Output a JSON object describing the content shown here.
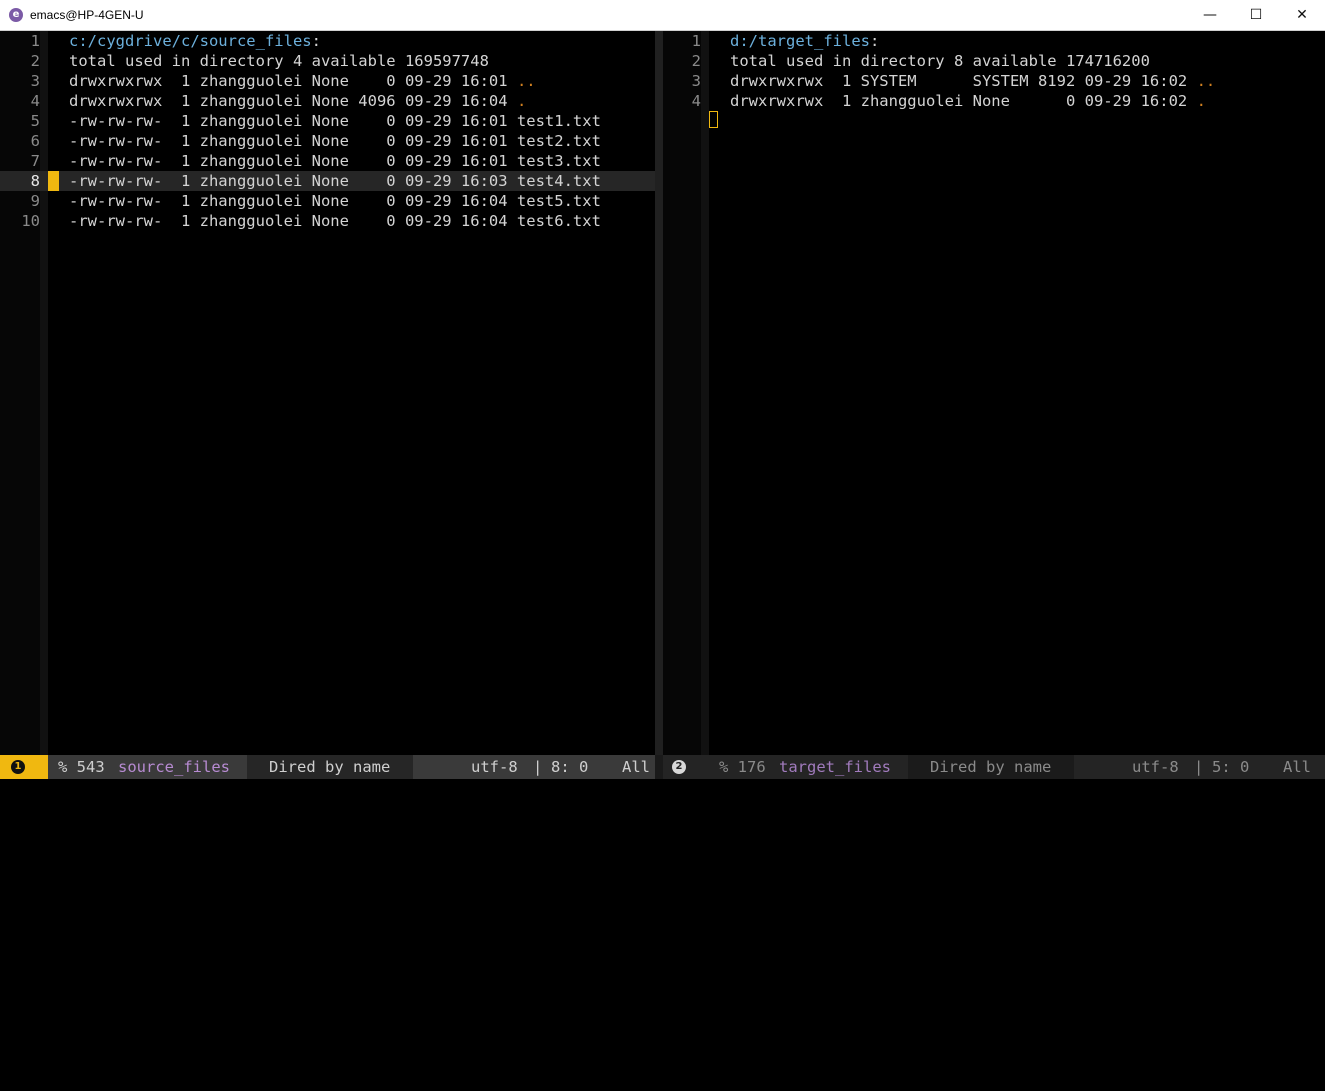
{
  "window": {
    "title": "emacs@HP-4GEN-U",
    "app_icon": "emacs-icon",
    "controls": {
      "minimize": "—",
      "maximize": "☐",
      "close": "✕"
    }
  },
  "left_pane": {
    "lines": [
      {
        "num": "1",
        "path": "c:/cygdrive/c/source_files",
        "suffix": ":"
      },
      {
        "num": "2",
        "text": "total used in directory 4 available 169597748"
      },
      {
        "num": "3",
        "text": "drwxrwxrwx  1 zhangguolei None    0 09-29 16:01 ",
        "link": ".."
      },
      {
        "num": "4",
        "text": "drwxrwxrwx  1 zhangguolei None 4096 09-29 16:04 ",
        "link": "."
      },
      {
        "num": "5",
        "text": "-rw-rw-rw-  1 zhangguolei None    0 09-29 16:01 test1.txt"
      },
      {
        "num": "6",
        "text": "-rw-rw-rw-  1 zhangguolei None    0 09-29 16:01 test2.txt"
      },
      {
        "num": "7",
        "text": "-rw-rw-rw-  1 zhangguolei None    0 09-29 16:01 test3.txt"
      },
      {
        "num": "8",
        "text": "-rw-rw-rw-  1 zhangguolei None    0 09-29 16:03 test4.txt"
      },
      {
        "num": "9",
        "text": "-rw-rw-rw-  1 zhangguolei None    0 09-29 16:04 test5.txt"
      },
      {
        "num": "10",
        "text": "-rw-rw-rw-  1 zhangguolei None    0 09-29 16:04 test6.txt"
      }
    ],
    "current_line": "8"
  },
  "right_pane": {
    "lines": [
      {
        "num": "1",
        "path": "d:/target_files",
        "suffix": ":"
      },
      {
        "num": "2",
        "text": "total used in directory 8 available 174716200"
      },
      {
        "num": "3",
        "text": "drwxrwxrwx  1 SYSTEM      SYSTEM 8192 09-29 16:02 ",
        "link": ".."
      },
      {
        "num": "4",
        "text": "drwxrwxrwx  1 zhangguolei None      0 09-29 16:02 ",
        "link": "."
      }
    ]
  },
  "modeline_left": {
    "window_number": "1",
    "percent": "% 543",
    "buffer": "source_files",
    "mode": "Dired by name",
    "encoding": "utf-8",
    "sep": "|",
    "position": "8: 0",
    "scroll": "All"
  },
  "modeline_right": {
    "window_number": "2",
    "percent": "% 176",
    "buffer": "target_files",
    "mode": "Dired by name",
    "encoding": "utf-8",
    "sep": "|",
    "position": "5: 0",
    "scroll": "All"
  },
  "colors": {
    "accent": "#f0b810",
    "directory": "#6cb0dc",
    "dotlink": "#d08020",
    "buffer_name": "#b78bd2"
  }
}
